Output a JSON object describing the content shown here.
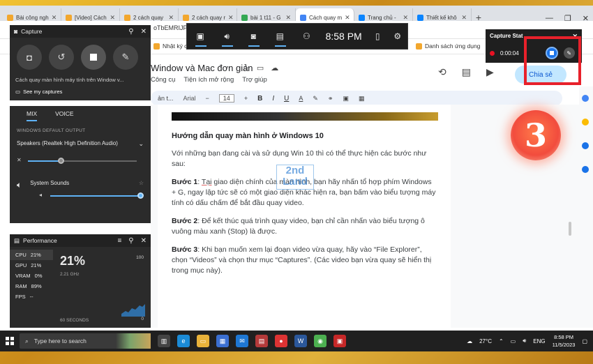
{
  "browser": {
    "tabs": [
      {
        "label": "Bài công ngh",
        "color": "#f2a72e"
      },
      {
        "label": "[Video] Cách",
        "color": "#f2a72e"
      },
      {
        "label": "2 cách quay",
        "color": "#f2a72e"
      },
      {
        "label": "2 cách quay r",
        "color": "#f2a72e"
      },
      {
        "label": "bài 1 t11 - G",
        "color": "#34a853"
      },
      {
        "label": "Cách quay m",
        "color": "#4285f4"
      },
      {
        "label": "Trang chủ - ",
        "color": "#0a84ff"
      },
      {
        "label": "Thiết kế khô",
        "color": "#0a84ff"
      }
    ],
    "new_tab": "+",
    "url_fragment": "oTbEMRIJPV",
    "bookmark_left": "Nhật ký công",
    "bookmark_apps": "Danh sách ứng dụng"
  },
  "doc": {
    "title": "Window và Mac đơn giản",
    "menu": [
      "Công cụ",
      "Tiện ích mở rộng",
      "Trợ giúp"
    ],
    "share_label": "Chia sẻ",
    "toolbar": {
      "font": "Arial",
      "size": "14",
      "bold": "B",
      "italic": "I",
      "underline": "U",
      "text_color": "A",
      "minus": "−",
      "plus": "+",
      "left_text": "ản t..."
    },
    "heading": "Hướng dẫn quay màn hình ở Windows 10",
    "intro": "Với những bạn đang cài và sử dụng Win 10 thì có thể thực hiện các bước như sau:",
    "steps": [
      {
        "label": "Bước 1",
        "pre": ": ",
        "ul": "Tại",
        "text": " giao diện chính của màn hình, bạn hãy nhấn tổ hợp phím Windows + G, ngay lập tức sẽ có một giao diện khác hiện ra, bạn bấm vào biểu tượng máy tính có dấu chấm để bắt đầu quay video."
      },
      {
        "label": "Bước 2",
        "pre": ": ",
        "ul": "",
        "text": "Để kết thúc quá trình quay video, bạn chỉ cần nhấn vào biểu tượng ô vuông màu xanh (Stop) là được."
      },
      {
        "label": "Bước 3",
        "pre": ": ",
        "ul": "",
        "text": "Khi bạn muốn xem lại đoạn video vừa quay, hãy vào “File Explorer”, chọn “Videos” và chọn thư mục “Captures”. (Các video bạn vừa quay sẽ hiển thị trong mục này)."
      }
    ],
    "watermark_top": "2nd",
    "watermark_bottom": "Land"
  },
  "gamebar": {
    "time": "8:58 PM"
  },
  "capture_widget": {
    "title": "Capture",
    "info": "Cách quay màn hình máy tính trên Window v...",
    "see_captures": "See my captures"
  },
  "audio_widget": {
    "tab_mix": "MIX",
    "tab_voice": "VOICE",
    "section": "WINDOWS DEFAULT OUTPUT",
    "device": "Speakers (Realtek High Definition Audio)",
    "system_sounds": "System Sounds",
    "master_level": 0.3,
    "system_level": 1.0
  },
  "performance_widget": {
    "title": "Performance",
    "stats": [
      {
        "name": "CPU",
        "value": "21%"
      },
      {
        "name": "GPU",
        "value": "21%"
      },
      {
        "name": "VRAM",
        "value": "0%"
      },
      {
        "name": "RAM",
        "value": "89%"
      },
      {
        "name": "FPS",
        "value": "--"
      }
    ],
    "big_value": "21%",
    "ghz": "2.21 GHz",
    "max": "100",
    "min": "0",
    "window": "60 SECONDS"
  },
  "capture_status": {
    "title": "Capture Stat",
    "time": "0:00:04"
  },
  "step_badge": "3",
  "taskbar": {
    "search_placeholder": "Type here to search",
    "weather": "27°C",
    "lang": "ENG",
    "time": "8:58 PM",
    "date": "11/5/2023"
  },
  "colors": {
    "accent": "#5fb2f5",
    "highlight": "#e8212b",
    "stop": "#1a73e8"
  }
}
